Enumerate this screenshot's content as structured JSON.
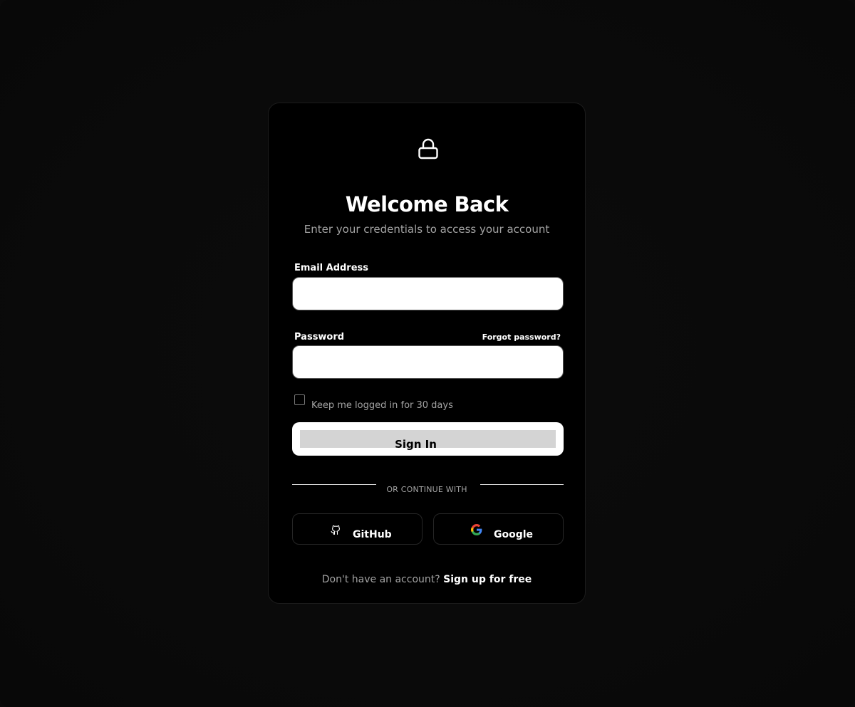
{
  "header": {
    "icon": "lock-icon",
    "title": "Welcome Back",
    "subtitle": "Enter your credentials to access your account"
  },
  "form": {
    "email": {
      "label": "Email Address",
      "value": ""
    },
    "password": {
      "label": "Password",
      "value": "",
      "forgot_label": "Forgot password?"
    },
    "remember": {
      "label": "Keep me logged in for 30 days",
      "checked": false
    },
    "submit_label": "Sign In"
  },
  "divider": {
    "label": "OR CONTINUE WITH"
  },
  "social": {
    "github": {
      "label": "GitHub",
      "icon": "github-icon"
    },
    "google": {
      "label": "Google",
      "icon": "google-icon"
    }
  },
  "footer": {
    "text": "Don't have an account?",
    "link": "Sign up for free"
  }
}
